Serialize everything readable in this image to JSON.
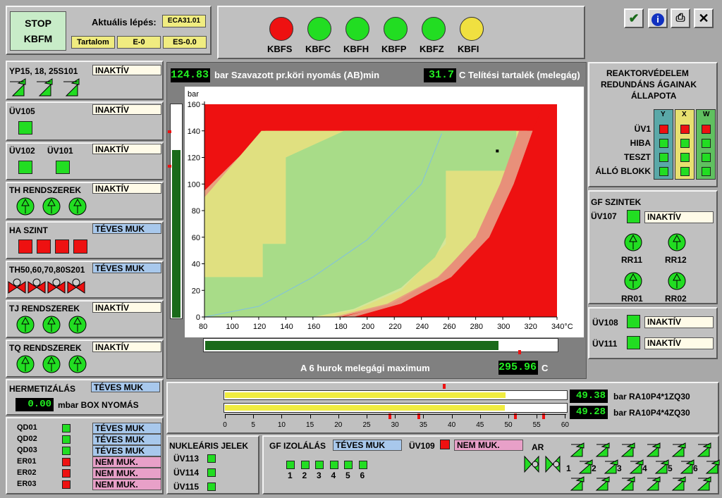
{
  "header": {
    "stop_line1": "STOP",
    "stop_line2": "KBFM",
    "step_label": "Aktuális lépés:",
    "step_value": "ECA31.01",
    "btn_tartalom": "Tartalom",
    "btn_e0": "E-0",
    "btn_es0": "ES-0.0"
  },
  "lamps": [
    {
      "label": "KBFS",
      "color": "#ee1111"
    },
    {
      "label": "KBFC",
      "color": "#22dd22"
    },
    {
      "label": "KBFH",
      "color": "#22dd22"
    },
    {
      "label": "KBFP",
      "color": "#22dd22"
    },
    {
      "label": "KBFZ",
      "color": "#22dd22"
    },
    {
      "label": "KBFI",
      "color": "#f0e040"
    }
  ],
  "toolbar_icons": [
    "check-icon",
    "info-icon",
    "printer-icon",
    "close-icon"
  ],
  "left": {
    "yp": {
      "title": "YP15,  18,  25S101",
      "status": "INAKTÍV"
    },
    "uv105": {
      "title": "ÜV105",
      "status": "INAKTÍV"
    },
    "uv102": {
      "title1": "ÜV102",
      "title2": "ÜV101",
      "status": "INAKTÍV"
    },
    "th": {
      "title": "TH RENDSZEREK",
      "status": "INAKTÍV"
    },
    "ha": {
      "title": "HA SZINT",
      "status": "TÉVES MUK"
    },
    "th50": {
      "title": "TH50,60,70,80S201",
      "status": "TÉVES MUK"
    },
    "tj": {
      "title": "TJ RENDSZEREK",
      "status": "INAKTÍV"
    },
    "tq": {
      "title": "TQ RENDSZEREK",
      "status": "INAKTÍV"
    },
    "herm": {
      "title": "HERMETIZÁLÁS",
      "status": "TÉVES MUK",
      "value": "0.00",
      "unit": "mbar BOX  NYOMÁS"
    },
    "qd_rows": [
      {
        "name": "QD01",
        "state": "green",
        "status": "TÉVES MUK"
      },
      {
        "name": "QD02",
        "state": "green",
        "status": "TÉVES MUK"
      },
      {
        "name": "QD03",
        "state": "green",
        "status": "TÉVES MUK"
      },
      {
        "name": "ER01",
        "state": "red",
        "status": "NEM MUK."
      },
      {
        "name": "ER02",
        "state": "red",
        "status": "NEM MUK."
      },
      {
        "name": "ER03",
        "state": "red",
        "status": "NEM MUK."
      }
    ]
  },
  "center": {
    "pressure_value": "124.83",
    "pressure_label": "bar  Szavazott pr.köri nyomás (AB)min",
    "subcool_value": "31.7",
    "subcool_label": "C Telítési tartalék (melegág)",
    "loop_label": "A 6 hurok melegági maximum",
    "loop_value": "295.96",
    "loop_unit": "C"
  },
  "chart_data": {
    "type": "area",
    "ylabel": "bar",
    "xlabel": "°C",
    "xlim": [
      80,
      340
    ],
    "ylim": [
      0,
      160
    ],
    "x_ticks": [
      80,
      100,
      120,
      140,
      160,
      180,
      200,
      220,
      240,
      260,
      280,
      300,
      320,
      340
    ],
    "y_ticks": [
      0,
      20,
      40,
      60,
      80,
      100,
      120,
      140,
      160
    ],
    "operating_point": {
      "x": 295.96,
      "y": 124.83
    },
    "x_tick_labels": [
      "80",
      "100",
      "120",
      "140",
      "160",
      "180",
      "200",
      "220",
      "240",
      "260",
      "280",
      "300",
      "320",
      "340°C"
    ],
    "y_tick_labels": [
      "0",
      "20",
      "40",
      "60",
      "80",
      "100",
      "120",
      "140",
      "160"
    ]
  },
  "bottom_center": {
    "val1": "49.38",
    "label1": "bar  RA10P4*1ZQ30",
    "val2": "49.28",
    "label2": "bar  RA10P4*4ZQ30",
    "fill1_fraction": 0.823,
    "fill2_fraction": 0.821,
    "scale": [
      "0",
      "5",
      "10",
      "15",
      "20",
      "25",
      "30",
      "35",
      "40",
      "45",
      "50",
      "55",
      "60"
    ]
  },
  "right": {
    "rv_title1": "REAKTORVÉDELEM",
    "rv_title2": "REDUNDÁNS ÁGAINAK",
    "rv_title3": "ÁLLAPOTA",
    "cols": [
      "Y",
      "X",
      "W"
    ],
    "rows": [
      {
        "label": "ÜV1",
        "states": [
          "red",
          "red",
          "red"
        ]
      },
      {
        "label": "HIBA",
        "states": [
          "green",
          "green",
          "green"
        ]
      },
      {
        "label": "TESZT",
        "states": [
          "green",
          "green",
          "green"
        ]
      },
      {
        "label": "ÁLLÓ BLOKK",
        "states": [
          "green",
          "green",
          "green"
        ]
      }
    ],
    "gf_title": "GF SZINTEK",
    "uv107": "ÜV107",
    "uv107_status": "INAKTÍV",
    "rr": [
      "RR11",
      "RR12",
      "RR01",
      "RR02"
    ],
    "uv108": "ÜV108",
    "uv108_status": "INAKTÍV",
    "uv111": "ÜV111",
    "uv111_status": "INAKTÍV"
  },
  "nuclear": {
    "title": "NUKLEÁRIS JELEK",
    "items": [
      "ÜV113",
      "ÜV114",
      "ÜV115"
    ]
  },
  "gf_iso": {
    "title": "GF IZOLÁLÁS",
    "status": "TÉVES MUK",
    "uv109": "ÜV109",
    "uv109_status": "NEM MUK.",
    "nums": [
      "1",
      "2",
      "3",
      "4",
      "5",
      "6"
    ],
    "ar": "AR"
  }
}
